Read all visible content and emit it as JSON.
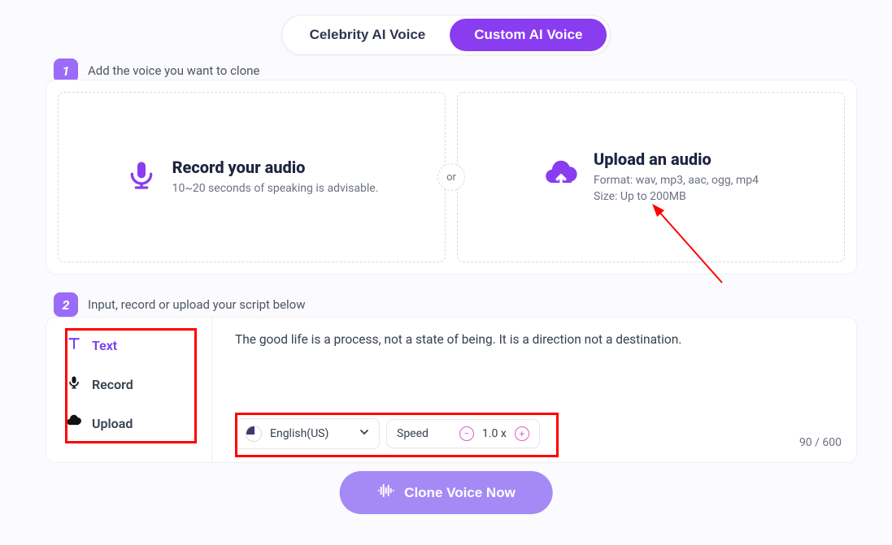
{
  "tabs": {
    "celebrity": "Celebrity AI Voice",
    "custom": "Custom AI Voice"
  },
  "step1": {
    "num": "1",
    "label": "Add the voice you want to clone",
    "or": "or",
    "record": {
      "title": "Record your audio",
      "subtitle": "10~20 seconds of speaking is advisable."
    },
    "upload": {
      "title": "Upload an audio",
      "line1": "Format: wav, mp3, aac, ogg, mp4",
      "line2": "Size: Up to 200MB"
    }
  },
  "step2": {
    "num": "2",
    "label": "Input, record or upload your script below",
    "tabs": {
      "text": "Text",
      "record": "Record",
      "upload": "Upload"
    },
    "script": "The good life is a process, not a state of being. It is a direction not a destination.",
    "language": "English(US)",
    "speed_label": "Speed",
    "speed_value": "1.0 x",
    "char_count": "90 / 600"
  },
  "cta": "Clone Voice Now"
}
